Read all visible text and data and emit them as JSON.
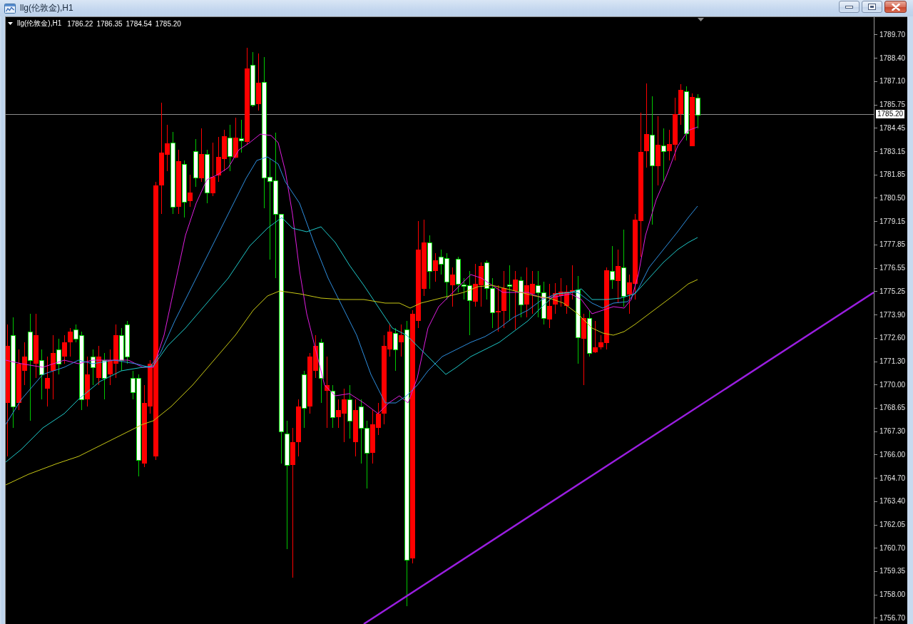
{
  "window": {
    "title": "llg(伦敦金),H1"
  },
  "chart": {
    "header": {
      "symbol": "llg(伦敦金),H1",
      "prices": [
        "1786.22",
        "1786.35",
        "1784.54",
        "1785.20"
      ]
    },
    "price_axis": {
      "labels": [
        "1789.70",
        "1788.40",
        "1787.10",
        "1785.75",
        "1784.45",
        "1783.15",
        "1781.85",
        "1780.50",
        "1779.15",
        "1777.85",
        "1776.55",
        "1775.25",
        "1773.90",
        "1772.60",
        "1771.30",
        "1770.00",
        "1768.65",
        "1767.30",
        "1766.00",
        "1764.70",
        "1763.40",
        "1762.05",
        "1760.70",
        "1759.35",
        "1758.00",
        "1756.70"
      ],
      "current_price": "1785.20"
    }
  }
}
